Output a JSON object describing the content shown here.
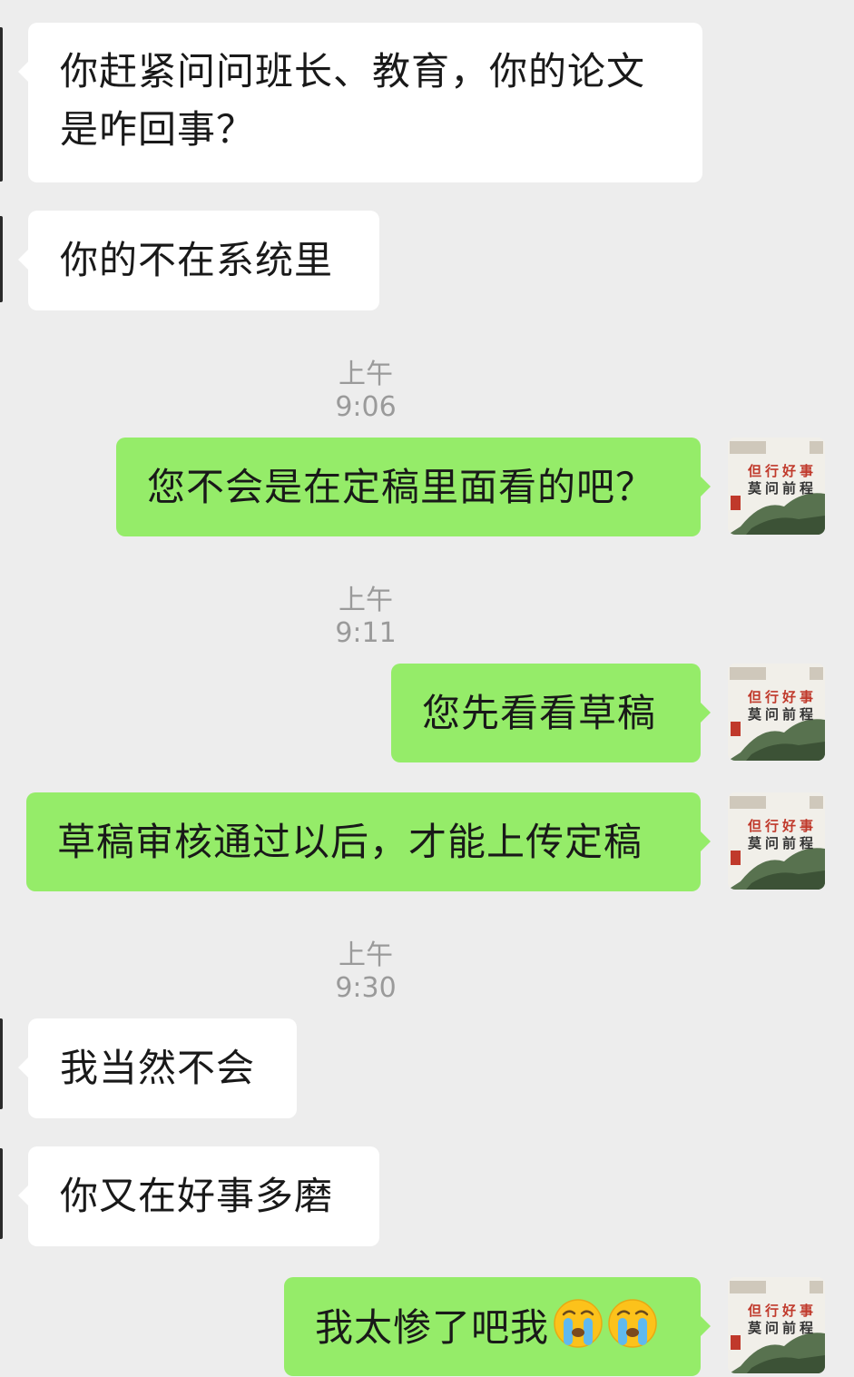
{
  "chat": {
    "messages": [
      {
        "side": "received",
        "text": "你赶紧问问班长、教育，你的论文\n是咋回事？"
      },
      {
        "side": "received",
        "text": "你的不在系统里"
      },
      {
        "side": "time",
        "text": "上午9:06"
      },
      {
        "side": "sent",
        "text": "您不会是在定稿里面看的吧？"
      },
      {
        "side": "time",
        "text": "上午9:11"
      },
      {
        "side": "sent",
        "text": "您先看看草稿"
      },
      {
        "side": "sent",
        "text": "草稿审核通过以后，才能上传定稿"
      },
      {
        "side": "time",
        "text": "上午9:30"
      },
      {
        "side": "received",
        "text": "我当然不会"
      },
      {
        "side": "received",
        "text": "你又在好事多磨"
      },
      {
        "side": "sent",
        "text": "我太惨了吧我",
        "emoji": [
          "crying-face",
          "crying-face"
        ]
      }
    ]
  },
  "avatar": {
    "line1": "但行好事",
    "line2": "莫问前程",
    "icon": "landscape-calligraphy-avatar"
  },
  "colors": {
    "background": "#ededed",
    "received_bubble": "#ffffff",
    "sent_bubble": "#95ec69",
    "text": "#191919",
    "timestamp": "#9a9a9a"
  }
}
